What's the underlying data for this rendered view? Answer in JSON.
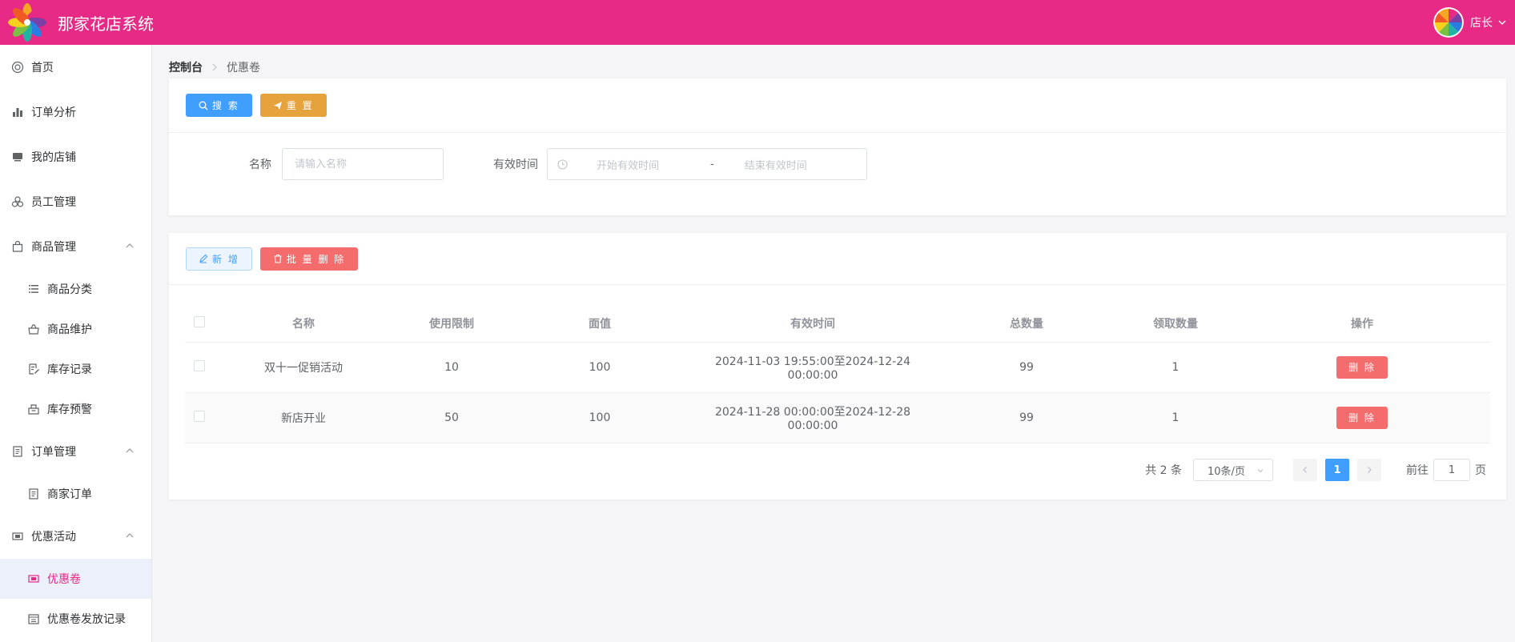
{
  "app": {
    "title": "那家花店系统",
    "user_name": "店长"
  },
  "breadcrumb": {
    "root": "控制台",
    "current": "优惠卷"
  },
  "sidebar": {
    "items": [
      {
        "label": "首页"
      },
      {
        "label": "订单分析"
      },
      {
        "label": "我的店铺"
      },
      {
        "label": "员工管理"
      },
      {
        "label": "商品管理"
      },
      {
        "label": "商品分类"
      },
      {
        "label": "商品维护"
      },
      {
        "label": "库存记录"
      },
      {
        "label": "库存预警"
      },
      {
        "label": "订单管理"
      },
      {
        "label": "商家订单"
      },
      {
        "label": "优惠活动"
      },
      {
        "label": "优惠卷"
      },
      {
        "label": "优惠卷发放记录"
      }
    ]
  },
  "search_panel": {
    "search_label": "搜 索",
    "reset_label": "重 置",
    "name_label": "名称",
    "name_placeholder": "请输入名称",
    "time_label": "有效时间",
    "start_placeholder": "开始有效时间",
    "range_sep": "-",
    "end_placeholder": "结束有效时间"
  },
  "actions": {
    "add_label": "新 增",
    "batch_delete_label": "批 量 删 除"
  },
  "table": {
    "columns": [
      "名称",
      "使用限制",
      "面值",
      "有效时间",
      "总数量",
      "领取数量",
      "操作"
    ],
    "rows": [
      {
        "name": "双十一促销活动",
        "limit": "10",
        "value": "100",
        "period": "2024-11-03 19:55:00至2024-12-24 00:00:00",
        "total": "99",
        "received": "1",
        "action": "删 除"
      },
      {
        "name": "新店开业",
        "limit": "50",
        "value": "100",
        "period": "2024-11-28 00:00:00至2024-12-28 00:00:00",
        "total": "99",
        "received": "1",
        "action": "删 除"
      }
    ]
  },
  "pagination": {
    "total_text": "共 2 条",
    "page_size": "10条/页",
    "current_page": "1",
    "goto_label": "前往",
    "goto_value": "1",
    "page_suffix": "页"
  },
  "colors": {
    "brand": "#e62a85",
    "primary": "#409eff",
    "warning": "#e6a23c",
    "danger": "#f56c6c"
  }
}
